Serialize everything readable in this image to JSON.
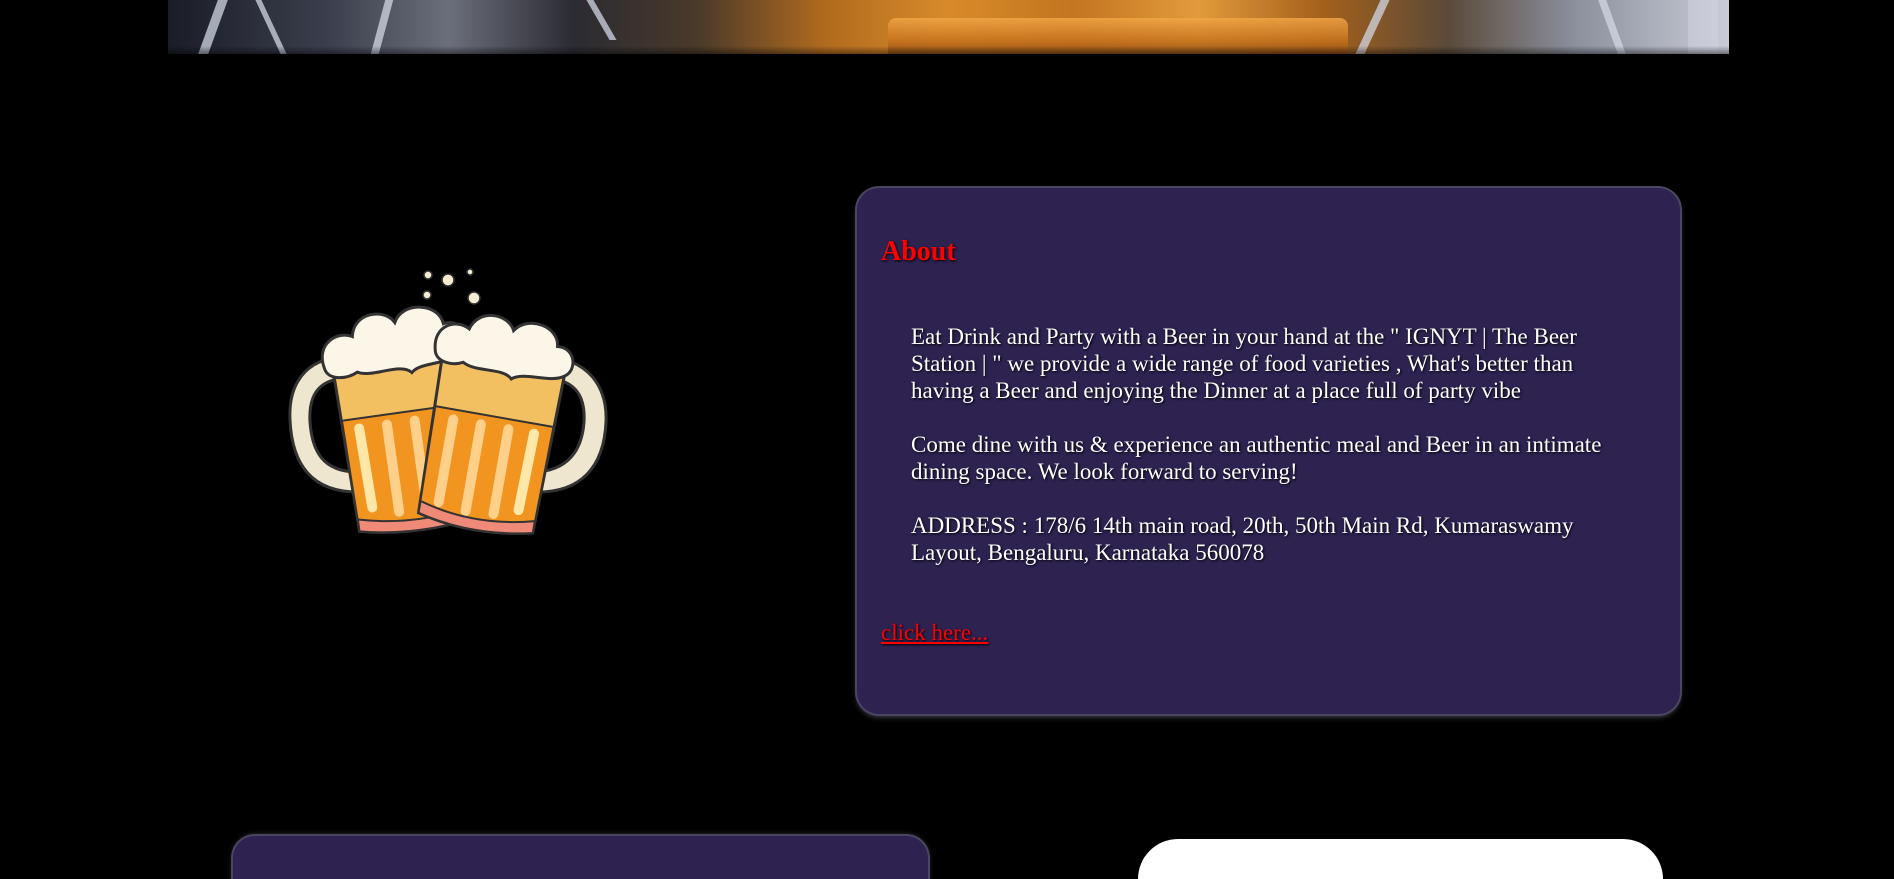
{
  "about": {
    "title": "About",
    "paragraphs": [
      "Eat Drink and Party with a Beer in your hand at the \" IGNYT | The Beer Station | \" we provide a wide range of food varieties , What's better than having a Beer and enjoying the Dinner at a place full of party vibe",
      "Come dine with us & experience an authentic meal and Beer in an intimate dining space. We look forward to serving!",
      "ADDRESS : 178/6 14th main road, 20th, 50th Main Rd, Kumaraswamy Layout, Bengaluru, Karnataka 560078"
    ],
    "link_label": "click here..."
  },
  "colors": {
    "background": "#000000",
    "card": "#2d2250",
    "accent": "#ff0000",
    "text": "#ffffff"
  },
  "images": {
    "hero": "restaurant-interior-banner",
    "illustration": "beer-mugs-cheers-icon"
  }
}
